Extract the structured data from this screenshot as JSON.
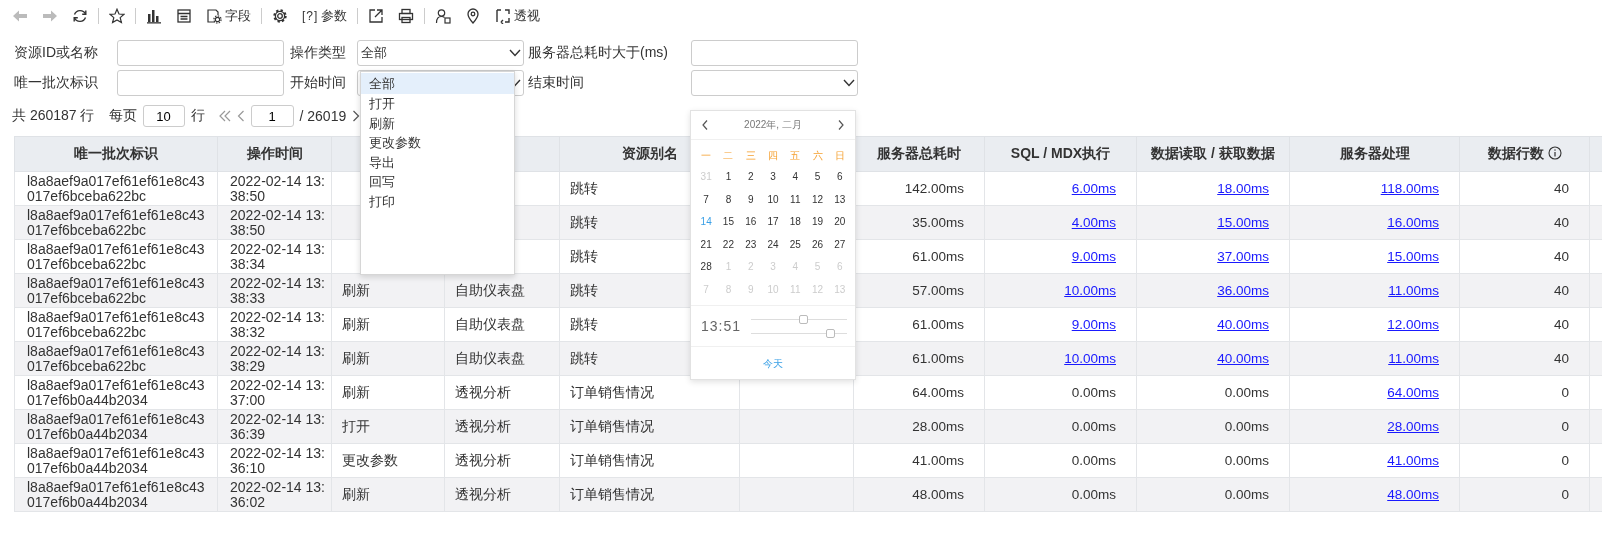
{
  "toolbar": [
    [
      {
        "kind": "back",
        "disabled": true
      },
      {
        "kind": "forward",
        "disabled": true
      },
      {
        "kind": "refresh",
        "disabled": false
      }
    ],
    [
      {
        "kind": "star",
        "disabled": false
      }
    ],
    [
      {
        "kind": "chart",
        "disabled": false
      },
      {
        "kind": "form",
        "disabled": false
      },
      {
        "kind": "fields",
        "label": "字段",
        "disabled": false
      }
    ],
    [
      {
        "kind": "gear",
        "disabled": false
      },
      {
        "kind": "params",
        "glyph": "[?]",
        "label": "参数",
        "disabled": false
      }
    ],
    [
      {
        "kind": "export",
        "disabled": false
      },
      {
        "kind": "print",
        "disabled": false
      }
    ],
    [
      {
        "kind": "user",
        "disabled": false
      },
      {
        "kind": "location",
        "disabled": false
      },
      {
        "kind": "pivot",
        "label": "透视",
        "disabled": false
      }
    ]
  ],
  "filters": [
    [
      {
        "label": "资源ID或名称",
        "kind": "input"
      },
      {
        "label": "操作类型",
        "kind": "select",
        "value": "全部"
      },
      {
        "label": "服务器总耗时大于(ms)",
        "kind": "input"
      }
    ],
    [
      {
        "label": "唯一批次标识",
        "kind": "input"
      },
      {
        "label": "开始时间",
        "kind": "select"
      },
      {
        "label": "结束时间",
        "kind": "select"
      }
    ]
  ],
  "pagination": {
    "total": "共 260187 行",
    "per_page_label": "每页",
    "per_page": "10",
    "rows_unit": "行",
    "page": "1",
    "page_count": "/ 26019"
  },
  "dropdown": {
    "options": [
      {
        "label": "全部",
        "selected": true
      },
      {
        "label": "打开",
        "selected": false
      },
      {
        "label": "刷新",
        "selected": false
      },
      {
        "label": "更改参数",
        "selected": false
      },
      {
        "label": "导出",
        "selected": false
      },
      {
        "label": "回写",
        "selected": false
      },
      {
        "label": "打印",
        "selected": false
      }
    ]
  },
  "calendar": {
    "title": "2022年, 二月",
    "weekdays": [
      "一",
      "二",
      "三",
      "四",
      "五",
      "六",
      "日"
    ],
    "weeks": [
      [
        {
          "text": "31",
          "muted": true,
          "today": false
        },
        {
          "text": "1",
          "muted": false,
          "today": false
        },
        {
          "text": "2",
          "muted": false,
          "today": false
        },
        {
          "text": "3",
          "muted": false,
          "today": false
        },
        {
          "text": "4",
          "muted": false,
          "today": false
        },
        {
          "text": "5",
          "muted": false,
          "today": false
        },
        {
          "text": "6",
          "muted": false,
          "today": false
        }
      ],
      [
        {
          "text": "7",
          "muted": false,
          "today": false
        },
        {
          "text": "8",
          "muted": false,
          "today": false
        },
        {
          "text": "9",
          "muted": false,
          "today": false
        },
        {
          "text": "10",
          "muted": false,
          "today": false
        },
        {
          "text": "11",
          "muted": false,
          "today": false
        },
        {
          "text": "12",
          "muted": false,
          "today": false
        },
        {
          "text": "13",
          "muted": false,
          "today": false
        }
      ],
      [
        {
          "text": "14",
          "muted": false,
          "today": true
        },
        {
          "text": "15",
          "muted": false,
          "today": false
        },
        {
          "text": "16",
          "muted": false,
          "today": false
        },
        {
          "text": "17",
          "muted": false,
          "today": false
        },
        {
          "text": "18",
          "muted": false,
          "today": false
        },
        {
          "text": "19",
          "muted": false,
          "today": false
        },
        {
          "text": "20",
          "muted": false,
          "today": false
        }
      ],
      [
        {
          "text": "21",
          "muted": false,
          "today": false
        },
        {
          "text": "22",
          "muted": false,
          "today": false
        },
        {
          "text": "23",
          "muted": false,
          "today": false
        },
        {
          "text": "24",
          "muted": false,
          "today": false
        },
        {
          "text": "25",
          "muted": false,
          "today": false
        },
        {
          "text": "26",
          "muted": false,
          "today": false
        },
        {
          "text": "27",
          "muted": false,
          "today": false
        }
      ],
      [
        {
          "text": "28",
          "muted": false,
          "today": false
        },
        {
          "text": "1",
          "muted": true,
          "today": false
        },
        {
          "text": "2",
          "muted": true,
          "today": false
        },
        {
          "text": "3",
          "muted": true,
          "today": false
        },
        {
          "text": "4",
          "muted": true,
          "today": false
        },
        {
          "text": "5",
          "muted": true,
          "today": false
        },
        {
          "text": "6",
          "muted": true,
          "today": false
        }
      ],
      [
        {
          "text": "7",
          "muted": true,
          "today": false
        },
        {
          "text": "8",
          "muted": true,
          "today": false
        },
        {
          "text": "9",
          "muted": true,
          "today": false
        },
        {
          "text": "10",
          "muted": true,
          "today": false
        },
        {
          "text": "11",
          "muted": true,
          "today": false
        },
        {
          "text": "12",
          "muted": true,
          "today": false
        },
        {
          "text": "13",
          "muted": true,
          "today": false
        }
      ]
    ],
    "time": "13:51",
    "sliders": [
      {
        "level": 0.55
      },
      {
        "level": 0.83
      }
    ],
    "today_button": "今天"
  },
  "table": {
    "columns": [
      {
        "label": "唯一批次标识"
      },
      {
        "label": "操作时间"
      },
      {},
      {},
      {
        "label": "资源别名"
      },
      {},
      {
        "label": "服务器总耗时"
      },
      {
        "label": "SQL / MDX执行"
      },
      {
        "label": "数据读取 / 获取数据"
      },
      {
        "label": "服务器处理"
      },
      {
        "label": "数据行数",
        "info": true
      },
      {}
    ],
    "rows": [
      {
        "batch_id": "l8a8aef9a017ef61ef61e8c43017ef6bceba622bc",
        "time": "2022-02-14 13:38:50",
        "alias": "跳转",
        "server_total": "142.00ms",
        "sql": {
          "text": "6.00ms",
          "link": true
        },
        "fetch": {
          "text": "18.00ms",
          "link": true
        },
        "processing": {
          "text": "118.00ms",
          "link": true
        },
        "row_count": "40"
      },
      {
        "batch_id": "l8a8aef9a017ef61ef61e8c43017ef6bceba622bc",
        "time": "2022-02-14 13:38:50",
        "alias": "跳转",
        "server_total": "35.00ms",
        "sql": {
          "text": "4.00ms",
          "link": true
        },
        "fetch": {
          "text": "15.00ms",
          "link": true
        },
        "processing": {
          "text": "16.00ms",
          "link": true
        },
        "row_count": "40"
      },
      {
        "batch_id": "l8a8aef9a017ef61ef61e8c43017ef6bceba622bc",
        "time": "2022-02-14 13:38:34",
        "alias": "跳转",
        "server_total": "61.00ms",
        "sql": {
          "text": "9.00ms",
          "link": true
        },
        "fetch": {
          "text": "37.00ms",
          "link": true
        },
        "processing": {
          "text": "15.00ms",
          "link": true
        },
        "row_count": "40"
      },
      {
        "batch_id": "l8a8aef9a017ef61ef61e8c43017ef6bceba622bc",
        "time": "2022-02-14 13:38:33",
        "operation": "刷新",
        "resource_type": "自助仪表盘",
        "alias": "跳转",
        "server_total": "57.00ms",
        "sql": {
          "text": "10.00ms",
          "link": true
        },
        "fetch": {
          "text": "36.00ms",
          "link": true
        },
        "processing": {
          "text": "11.00ms",
          "link": true
        },
        "row_count": "40"
      },
      {
        "batch_id": "l8a8aef9a017ef61ef61e8c43017ef6bceba622bc",
        "time": "2022-02-14 13:38:32",
        "operation": "刷新",
        "resource_type": "自助仪表盘",
        "alias": "跳转",
        "server_total": "61.00ms",
        "sql": {
          "text": "9.00ms",
          "link": true
        },
        "fetch": {
          "text": "40.00ms",
          "link": true
        },
        "processing": {
          "text": "12.00ms",
          "link": true
        },
        "row_count": "40"
      },
      {
        "batch_id": "l8a8aef9a017ef61ef61e8c43017ef6bceba622bc",
        "time": "2022-02-14 13:38:29",
        "operation": "刷新",
        "resource_type": "自助仪表盘",
        "alias": "跳转",
        "server_total": "61.00ms",
        "sql": {
          "text": "10.00ms",
          "link": true
        },
        "fetch": {
          "text": "40.00ms",
          "link": true
        },
        "processing": {
          "text": "11.00ms",
          "link": true
        },
        "row_count": "40"
      },
      {
        "batch_id": "l8a8aef9a017ef61ef61e8c43017ef6b0a44b2034",
        "time": "2022-02-14 13:37:00",
        "operation": "刷新",
        "resource_type": "透视分析",
        "alias": "订单销售情况",
        "server_total": "64.00ms",
        "sql": {
          "text": "0.00ms",
          "link": false
        },
        "fetch": {
          "text": "0.00ms",
          "link": false
        },
        "processing": {
          "text": "64.00ms",
          "link": true
        },
        "row_count": "0"
      },
      {
        "batch_id": "l8a8aef9a017ef61ef61e8c43017ef6b0a44b2034",
        "time": "2022-02-14 13:36:39",
        "operation": "打开",
        "resource_type": "透视分析",
        "alias": "订单销售情况",
        "server_total": "28.00ms",
        "sql": {
          "text": "0.00ms",
          "link": false
        },
        "fetch": {
          "text": "0.00ms",
          "link": false
        },
        "processing": {
          "text": "28.00ms",
          "link": true
        },
        "row_count": "0"
      },
      {
        "batch_id": "l8a8aef9a017ef61ef61e8c43017ef6b0a44b2034",
        "time": "2022-02-14 13:36:10",
        "operation": "更改参数",
        "resource_type": "透视分析",
        "alias": "订单销售情况",
        "server_total": "41.00ms",
        "sql": {
          "text": "0.00ms",
          "link": false
        },
        "fetch": {
          "text": "0.00ms",
          "link": false
        },
        "processing": {
          "text": "41.00ms",
          "link": true
        },
        "row_count": "0"
      },
      {
        "batch_id": "l8a8aef9a017ef61ef61e8c43017ef6b0a44b2034",
        "time": "2022-02-14 13:36:02",
        "operation": "刷新",
        "resource_type": "透视分析",
        "alias": "订单销售情况",
        "server_total": "48.00ms",
        "sql": {
          "text": "0.00ms",
          "link": false
        },
        "fetch": {
          "text": "0.00ms",
          "link": false
        },
        "processing": {
          "text": "48.00ms",
          "link": true
        },
        "row_count": "0"
      }
    ]
  }
}
